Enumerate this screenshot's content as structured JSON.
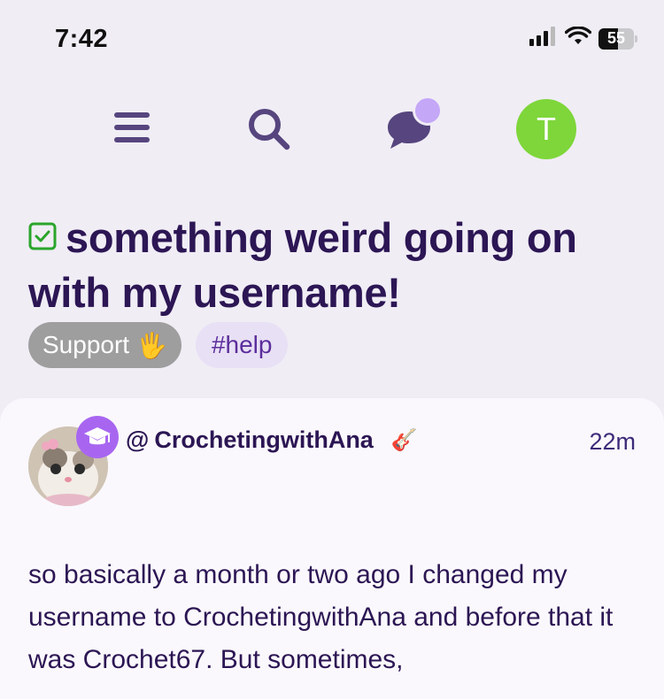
{
  "status_bar": {
    "time": "7:42",
    "battery": "55",
    "battery_level": 0.55,
    "icons": [
      "signal-icon",
      "wifi-icon",
      "battery-icon"
    ]
  },
  "nav": {
    "icons": [
      "menu-icon",
      "search-icon",
      "chat-bubble-icon"
    ],
    "avatar_initial": "T",
    "colors": {
      "icon": "#56457e",
      "avatar_bg": "#7ed63a",
      "notif_dot": "#c4a7f7"
    }
  },
  "post": {
    "title": "something weird going on with my username!",
    "solved_icon": "checkbox-check-icon",
    "tags": {
      "support": "Support",
      "support_emoji": "🖐",
      "help": "#help"
    },
    "author": {
      "prefix": "@",
      "name": "CrochetingwithAna",
      "flair_emoji": "🎸",
      "badge_icon": "graduation-cap-icon"
    },
    "time_ago": "22m",
    "body": "so basically a month or two ago I changed my username to CrochetingwithAna and before that it was Crochet67. But sometimes,"
  },
  "colors": {
    "background": "#f0edf5",
    "title": "#2c1654",
    "accent": "#a866f0",
    "tag_support_bg": "#9e9e9e",
    "tag_help_bg": "#e8e0f5"
  }
}
